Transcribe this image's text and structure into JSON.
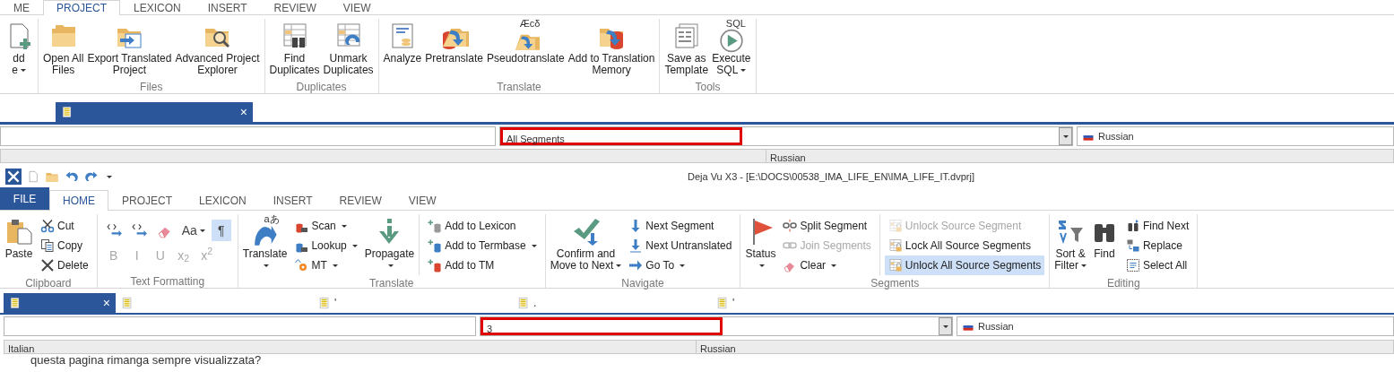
{
  "top_window": {
    "ribbon_tabs": [
      {
        "label": "ME",
        "selected": false
      },
      {
        "label": "PROJECT",
        "selected": true
      },
      {
        "label": "LEXICON",
        "selected": false
      },
      {
        "label": "INSERT",
        "selected": false
      },
      {
        "label": "REVIEW",
        "selected": false
      },
      {
        "label": "VIEW",
        "selected": false
      }
    ],
    "ribbon_groups": [
      {
        "columns": [
          {
            "kind": "large",
            "lines": [
              "dd",
              "e"
            ],
            "dropdown": true
          }
        ]
      },
      {
        "label": "Files",
        "columns": [
          {
            "kind": "large",
            "lines": [
              "Open All",
              "Files"
            ],
            "dropdown": false
          },
          {
            "kind": "large",
            "lines": [
              "Export Translated",
              "Project"
            ],
            "dropdown": false
          },
          {
            "kind": "large",
            "lines": [
              "Advanced Project",
              "Explorer"
            ],
            "dropdown": false
          }
        ]
      },
      {
        "label": "Duplicates",
        "columns": [
          {
            "kind": "large",
            "lines": [
              "Find",
              "Duplicates"
            ],
            "dropdown": false
          },
          {
            "kind": "large",
            "lines": [
              "Unmark",
              "Duplicates"
            ],
            "dropdown": false
          }
        ]
      },
      {
        "label": "Translate",
        "columns": [
          {
            "kind": "large",
            "lines": [
              "Analyze"
            ],
            "dropdown": false
          },
          {
            "kind": "large",
            "lines": [
              "Pretranslate"
            ],
            "dropdown": false
          },
          {
            "kind": "large",
            "lines": [
              "Pseudotranslate"
            ],
            "dropdown": false,
            "icon_text": "Æcδ"
          },
          {
            "kind": "large",
            "lines": [
              "Add to Translation",
              "Memory"
            ],
            "dropdown": false
          }
        ]
      },
      {
        "label": "Tools",
        "columns": [
          {
            "kind": "large",
            "lines": [
              "Save as",
              "Template"
            ],
            "dropdown": false
          },
          {
            "kind": "large",
            "lines": [
              "Execute",
              "SQL"
            ],
            "dropdown": true,
            "icon_text": "SQL"
          }
        ]
      }
    ],
    "document_tabs": [
      {
        "selected": true,
        "close": "×"
      }
    ],
    "filter": {
      "value": "All Segments",
      "highlighted": true
    },
    "language": "Russian",
    "grid_columns": [
      {
        "label": "Russian"
      }
    ]
  },
  "main_window": {
    "title": "Deja Vu X3 - [E:\\DOCS\\00538_IMA_LIFE_EN\\IMA_LIFE_IT.dvprj]",
    "file_tab": "FILE",
    "ribbon_tabs": [
      {
        "label": "HOME",
        "selected": true
      },
      {
        "label": "PROJECT",
        "selected": false
      },
      {
        "label": "LEXICON",
        "selected": false
      },
      {
        "label": "INSERT",
        "selected": false
      },
      {
        "label": "REVIEW",
        "selected": false
      },
      {
        "label": "VIEW",
        "selected": false
      }
    ],
    "ribbon_groups": [
      {
        "label": "Clipboard",
        "columns": [
          {
            "kind": "large",
            "lines": [
              "Paste"
            ],
            "dropdown": false
          },
          {
            "kind": "stack",
            "items": [
              {
                "label": "Cut",
                "dropdown": false,
                "disabled": false,
                "highlighted": false
              },
              {
                "label": "Copy",
                "dropdown": false,
                "disabled": false,
                "highlighted": false
              },
              {
                "label": "Delete",
                "dropdown": false,
                "disabled": false,
                "highlighted": false
              }
            ]
          }
        ]
      },
      {
        "label": "Text Formatting",
        "columns": [
          {
            "kind": "toolgrid",
            "rows": [
              [
                {
                  "dropdown": false,
                  "disabled": false,
                  "highlighted": false
                },
                {
                  "dropdown": false,
                  "disabled": false,
                  "highlighted": false
                },
                {
                  "dropdown": false,
                  "disabled": false,
                  "highlighted": false
                },
                {
                  "label": "Aa",
                  "dropdown": true,
                  "disabled": false,
                  "highlighted": false
                },
                {
                  "label": "¶",
                  "dropdown": false,
                  "disabled": false,
                  "highlighted": true
                }
              ],
              [
                {
                  "label": "B",
                  "dropdown": false,
                  "disabled": true,
                  "highlighted": false
                },
                {
                  "label": "I",
                  "dropdown": false,
                  "disabled": true,
                  "highlighted": false
                },
                {
                  "label": "U",
                  "dropdown": false,
                  "disabled": true,
                  "highlighted": false
                },
                {
                  "label": "x$_{2}$",
                  "dropdown": false,
                  "disabled": true,
                  "highlighted": false
                },
                {
                  "label": "x$^{2}$",
                  "dropdown": false,
                  "disabled": true,
                  "highlighted": false
                }
              ]
            ]
          }
        ]
      },
      {
        "label": "Translate",
        "columns": [
          {
            "kind": "large",
            "lines": [
              "Translate"
            ],
            "dropdown": true,
            "icon_text": "aあ"
          },
          {
            "kind": "stack",
            "items": [
              {
                "label": "Scan",
                "dropdown": true,
                "disabled": false,
                "highlighted": false
              },
              {
                "label": "Lookup",
                "dropdown": true,
                "disabled": false,
                "highlighted": false
              },
              {
                "label": "MT",
                "dropdown": true,
                "disabled": false,
                "highlighted": false
              }
            ]
          },
          {
            "kind": "large",
            "lines": [
              "Propagate"
            ],
            "dropdown": true
          },
          {
            "kind": "stack",
            "divided": true,
            "items": [
              {
                "label": "Add to Lexicon",
                "dropdown": false,
                "disabled": false,
                "highlighted": false
              },
              {
                "label": "Add to Termbase",
                "dropdown": true,
                "disabled": false,
                "highlighted": false
              },
              {
                "label": "Add to TM",
                "dropdown": false,
                "disabled": false,
                "highlighted": false
              }
            ]
          }
        ]
      },
      {
        "label": "Navigate",
        "columns": [
          {
            "kind": "large",
            "lines": [
              "Confirm and",
              "Move to Next"
            ],
            "dropdown": true
          },
          {
            "kind": "stack",
            "items": [
              {
                "label": "Next Segment",
                "dropdown": false,
                "disabled": false,
                "highlighted": false
              },
              {
                "label": "Next Untranslated",
                "dropdown": false,
                "disabled": false,
                "highlighted": false
              },
              {
                "label": "Go To",
                "dropdown": true,
                "disabled": false,
                "highlighted": false
              }
            ]
          }
        ]
      },
      {
        "label": "Segments",
        "columns": [
          {
            "kind": "large",
            "lines": [
              "Status"
            ],
            "dropdown": true
          },
          {
            "kind": "stack",
            "items": [
              {
                "label": "Split Segment",
                "dropdown": false,
                "disabled": false,
                "highlighted": false
              },
              {
                "label": "Join Segments",
                "dropdown": false,
                "disabled": true,
                "highlighted": false
              },
              {
                "label": "Clear",
                "dropdown": true,
                "disabled": false,
                "highlighted": false
              }
            ]
          },
          {
            "kind": "stack",
            "divided": true,
            "items": [
              {
                "label": "Unlock Source Segment",
                "dropdown": false,
                "disabled": true,
                "highlighted": false
              },
              {
                "label": "Lock All Source Segments",
                "dropdown": false,
                "disabled": false,
                "highlighted": false
              },
              {
                "label": "Unlock All Source Segments",
                "dropdown": false,
                "disabled": false,
                "highlighted": true
              }
            ]
          }
        ]
      },
      {
        "label": "Editing",
        "columns": [
          {
            "kind": "large",
            "lines": [
              "Sort &",
              "Filter"
            ],
            "dropdown": true
          },
          {
            "kind": "large",
            "lines": [
              "Find"
            ],
            "dropdown": false
          },
          {
            "kind": "stack",
            "items": [
              {
                "label": "Find Next",
                "dropdown": false,
                "disabled": false,
                "highlighted": false
              },
              {
                "label": "Replace",
                "dropdown": false,
                "disabled": false,
                "highlighted": false
              },
              {
                "label": "Select All",
                "dropdown": false,
                "disabled": false,
                "highlighted": false
              }
            ]
          }
        ]
      }
    ],
    "document_tabs": [
      {
        "selected": true,
        "close": "×"
      },
      {
        "selected": false
      },
      {
        "label": "'",
        "selected": false
      },
      {
        "label": ".",
        "selected": false
      },
      {
        "label": "'",
        "selected": false
      }
    ],
    "filter": {
      "value": "3",
      "highlighted": true
    },
    "language": "Russian",
    "grid_columns": [
      {
        "label": "Italian"
      },
      {
        "label": "Russian"
      }
    ],
    "rows": [
      {
        "source": "questa pagina rimanga sempre visualizzata?"
      }
    ]
  }
}
